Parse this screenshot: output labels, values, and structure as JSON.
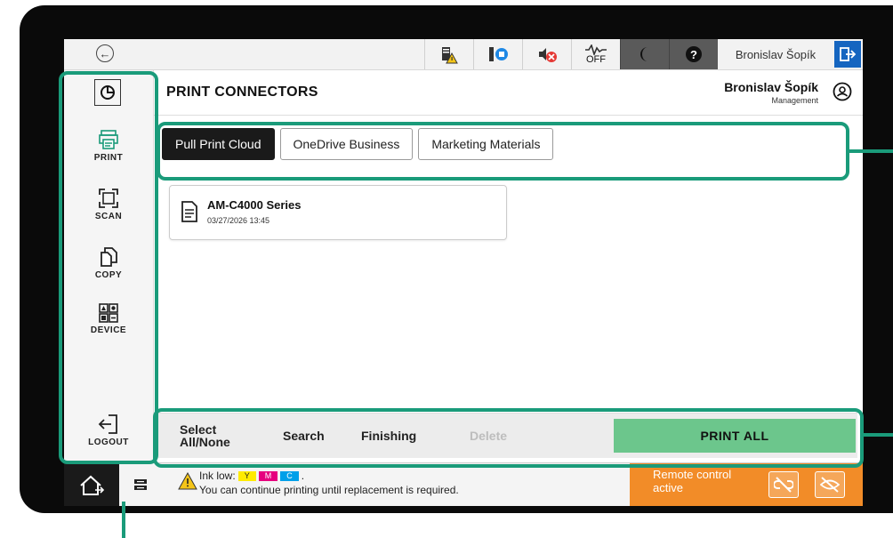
{
  "topbar": {
    "back_icon": "back-arrow-icon",
    "icons": [
      "toner-warning-icon",
      "ink-status-icon",
      "sound-muted-icon",
      "eco-off-icon",
      "sleep-mode-icon",
      "help-icon"
    ],
    "eco_label": "OFF",
    "user": "Bronislav Šopík",
    "logout_icon": "exit-icon"
  },
  "leftnav": {
    "items": [
      {
        "label": "PRINT",
        "icon": "print-icon"
      },
      {
        "label": "SCAN",
        "icon": "scan-icon"
      },
      {
        "label": "COPY",
        "icon": "copy-icon"
      },
      {
        "label": "DEVICE",
        "icon": "device-icon"
      },
      {
        "label": "LOGOUT",
        "icon": "logout-icon"
      }
    ]
  },
  "header": {
    "title": "PRINT CONNECTORS",
    "user_name": "Bronislav Šopík",
    "user_role": "Management"
  },
  "tabs": [
    {
      "label": "Pull Print Cloud",
      "active": true
    },
    {
      "label": "OneDrive Business",
      "active": false
    },
    {
      "label": "Marketing Materials",
      "active": false
    }
  ],
  "jobs": [
    {
      "title": "AM-C4000 Series",
      "date": "03/27/2026 13:45"
    }
  ],
  "actions": {
    "select_all_line1": "Select",
    "select_all_line2": "All/None",
    "search": "Search",
    "finishing": "Finishing",
    "delete": "Delete",
    "print_all": "PRINT ALL"
  },
  "status": {
    "ink_low_label": "Ink low:",
    "ink_colors": [
      {
        "label": "Y",
        "color": "#ffeb00"
      },
      {
        "label": "M",
        "color": "#e6007e"
      },
      {
        "label": "C",
        "color": "#00a0e9"
      }
    ],
    "ink_period": ".",
    "message": "You can continue printing until replacement is required.",
    "remote_text": "Remote control active"
  },
  "colors": {
    "highlight": "#1a9b7a",
    "print_all_bg": "#6cc68c",
    "remote_bg": "#f28c28",
    "exit_btn": "#1565c0"
  }
}
